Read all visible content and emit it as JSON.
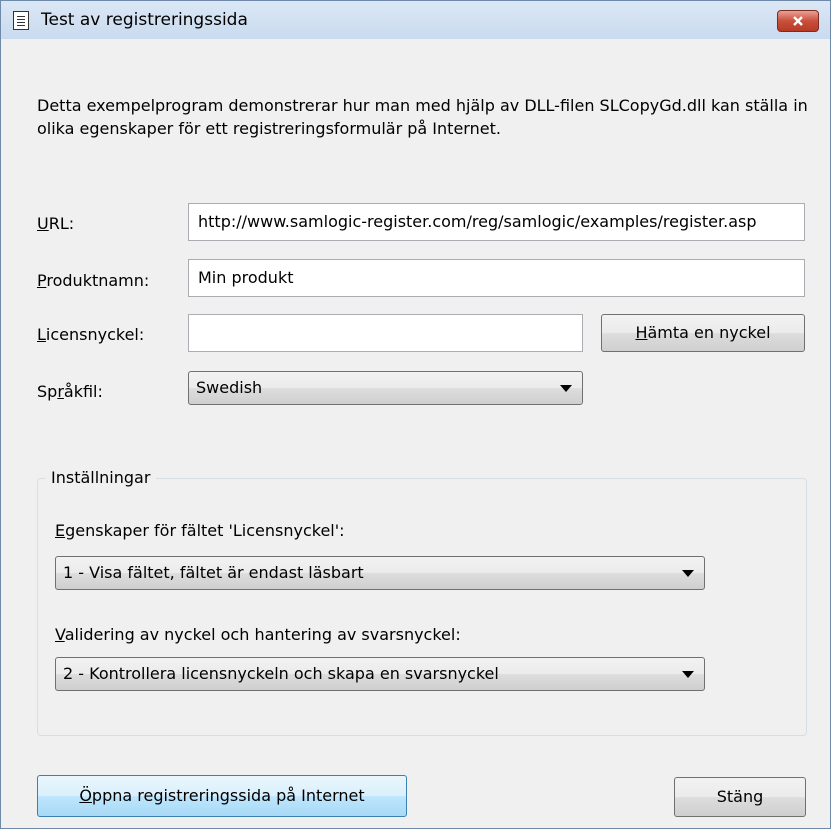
{
  "window": {
    "title": "Test av registreringssida"
  },
  "intro_text": "Detta exempelprogram demonstrerar hur man med hjälp av DLL-filen SLCopyGd.dll kan ställa in olika egenskaper för ett registreringsformulär på Internet.",
  "url": {
    "label_key": "U",
    "label_rest": "RL:",
    "value": "http://www.samlogic-register.com/reg/samlogic/examples/register.asp"
  },
  "product": {
    "label_key": "P",
    "label_rest": "roduktnamn:",
    "value": "Min produkt"
  },
  "license": {
    "label_key": "L",
    "label_rest": "icensnyckel:",
    "value": "",
    "button_key": "H",
    "button_rest": "ämta en nyckel"
  },
  "language": {
    "label_pre": "Sp",
    "label_key": "r",
    "label_rest": "åkfil:",
    "selected": "Swedish"
  },
  "settings": {
    "legend": "Inställningar",
    "license_field": {
      "label_key": "E",
      "label_rest": "genskaper för fältet 'Licensnyckel':",
      "selected": "1 - Visa fältet, fältet är endast läsbart"
    },
    "validation": {
      "label_key": "V",
      "label_rest": "alidering av nyckel och hantering av svarsnyckel:",
      "selected": "2 - Kontrollera licensnyckeln och skapa en svarsnyckel"
    }
  },
  "buttons": {
    "open_key": "Ö",
    "open_rest": "ppna registreringssida på Internet",
    "close": "Stäng"
  },
  "colors": {
    "window_bg": "#f0f0f0",
    "titlebar": "#dbe7f5",
    "close_button": "#c9503c",
    "primary_button": "#bee6fd"
  }
}
